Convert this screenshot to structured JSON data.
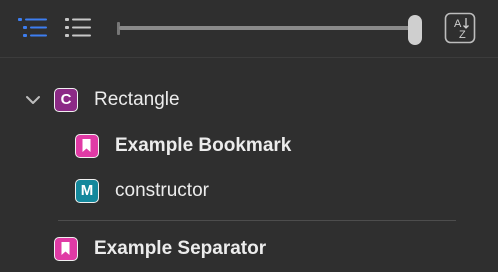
{
  "toolbar": {
    "hierarchy_icon": "hierarchical-list-icon",
    "flat_list_icon": "flat-list-icon",
    "sort_icon": "sort-alphabetically-icon",
    "sort_icon_text": "AZ",
    "slider_level": 1.0
  },
  "colors": {
    "selected_icon": "#3d7ef0",
    "unselected_icon": "#c8c8c8",
    "class_badge": "#8c2a86",
    "bookmark_badge": "#e03aa5",
    "method_badge": "#14889c"
  },
  "outline": {
    "items": [
      {
        "badge": "C",
        "kind": "class",
        "label": "Rectangle",
        "bold": false,
        "expanded": true
      },
      {
        "badge": "bookmark",
        "kind": "bookmark",
        "label": "Example Bookmark",
        "bold": true
      },
      {
        "badge": "M",
        "kind": "method",
        "label": "constructor",
        "bold": false
      },
      {
        "badge": "bookmark",
        "kind": "bookmark",
        "label": "Example Separator",
        "bold": true
      }
    ]
  }
}
